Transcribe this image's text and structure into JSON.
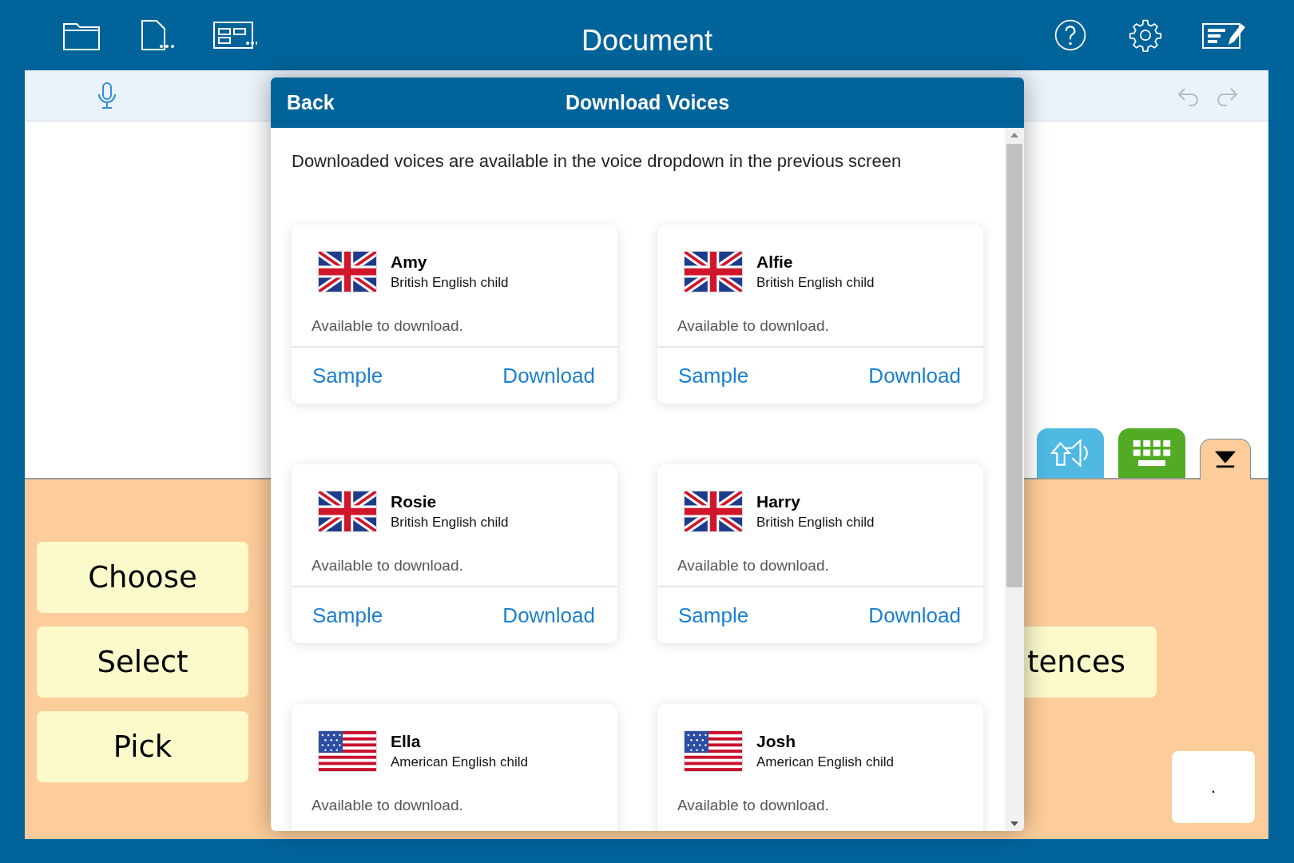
{
  "app_bar": {
    "title": "Document"
  },
  "modal": {
    "back": "Back",
    "title": "Download Voices",
    "intro": "Downloaded voices are available in the voice dropdown in the previous screen",
    "voices": [
      {
        "name": "Amy",
        "description": "British English child",
        "kind": "uk",
        "status": "Available to download.",
        "sample": "Sample",
        "download": "Download"
      },
      {
        "name": "Alfie",
        "description": "British English child",
        "kind": "uk",
        "status": "Available to download.",
        "sample": "Sample",
        "download": "Download"
      },
      {
        "name": "Rosie",
        "description": "British English child",
        "kind": "uk",
        "status": "Available to download.",
        "sample": "Sample",
        "download": "Download"
      },
      {
        "name": "Harry",
        "description": "British English child",
        "kind": "uk",
        "status": "Available to download.",
        "sample": "Sample",
        "download": "Download"
      },
      {
        "name": "Ella",
        "description": "American English child",
        "kind": "us",
        "status": "Available to download."
      },
      {
        "name": "Josh",
        "description": "American English child",
        "kind": "us",
        "status": "Available to download."
      }
    ]
  },
  "tabs": [
    {
      "kind": "speech",
      "color": "#4fb9e3",
      "selected": false
    },
    {
      "kind": "keyboard",
      "color": "#52ab24",
      "selected": false
    },
    {
      "kind": "collapse",
      "color": "#fccd9a",
      "selected": true
    }
  ],
  "word_buttons": [
    "Choose",
    "Select",
    "Pick"
  ],
  "side_button": "tences",
  "punctuation_key": "."
}
